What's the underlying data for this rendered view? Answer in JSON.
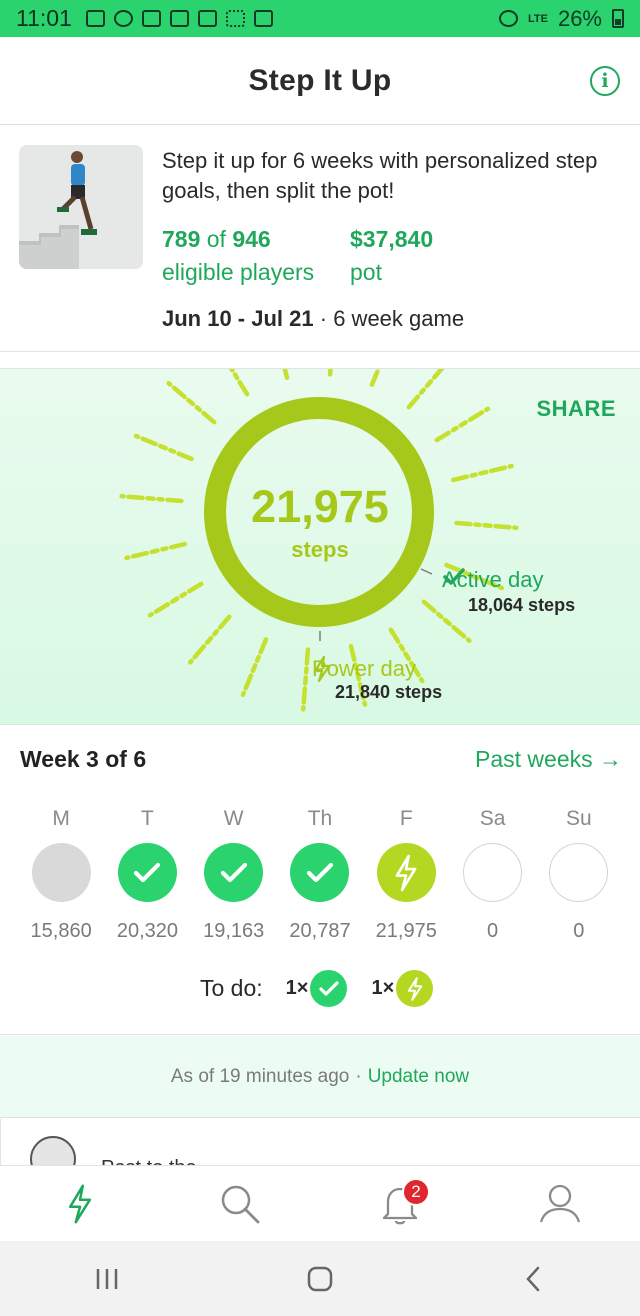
{
  "status_bar": {
    "time": "11:01",
    "battery": "26%",
    "network": "LTE"
  },
  "header": {
    "title": "Step It Up",
    "info_icon": "info-icon"
  },
  "game": {
    "description": "Step it up for 6 weeks with personalized step goals, then split the pot!",
    "players_count": "789",
    "players_of": "of",
    "players_total": "946",
    "players_label": "eligible players",
    "pot_amount": "$37,840",
    "pot_label": "pot",
    "date_range": "Jun 10 - Jul 21",
    "separator": "·",
    "duration": "6 week game"
  },
  "progress": {
    "share_label": "SHARE",
    "steps": "21,975",
    "steps_label": "steps",
    "active_day_label": "Active day",
    "active_day_steps": "18,064 steps",
    "power_day_label": "Power day",
    "power_day_steps": "21,840 steps",
    "ring_color": "#a6c81a",
    "rays_color": "#c5e02e"
  },
  "week": {
    "title": "Week 3 of 6",
    "past_weeks_label": "Past weeks →",
    "days": [
      {
        "label": "M",
        "status": "missed",
        "steps": "15,860"
      },
      {
        "label": "T",
        "status": "active",
        "steps": "20,320"
      },
      {
        "label": "W",
        "status": "active",
        "steps": "19,163"
      },
      {
        "label": "Th",
        "status": "active",
        "steps": "20,787"
      },
      {
        "label": "F",
        "status": "power",
        "steps": "21,975"
      },
      {
        "label": "Sa",
        "status": "future",
        "steps": "0"
      },
      {
        "label": "Su",
        "status": "future",
        "steps": "0"
      }
    ],
    "todo_label": "To do:",
    "todo_active_count": "1×",
    "todo_power_count": "1×"
  },
  "update": {
    "as_of": "As of 19 minutes ago",
    "separator": "·",
    "update_now": "Update now"
  },
  "peek": {
    "text": "Post to the"
  },
  "bottom_nav": {
    "items": [
      "bolt-icon",
      "search-icon",
      "bell-icon",
      "profile-icon"
    ],
    "notification_count": "2"
  },
  "colors": {
    "brand_green": "#1fa85b",
    "status_green": "#2bd36f",
    "power_lime": "#b4d821",
    "badge_red": "#e0262f"
  }
}
